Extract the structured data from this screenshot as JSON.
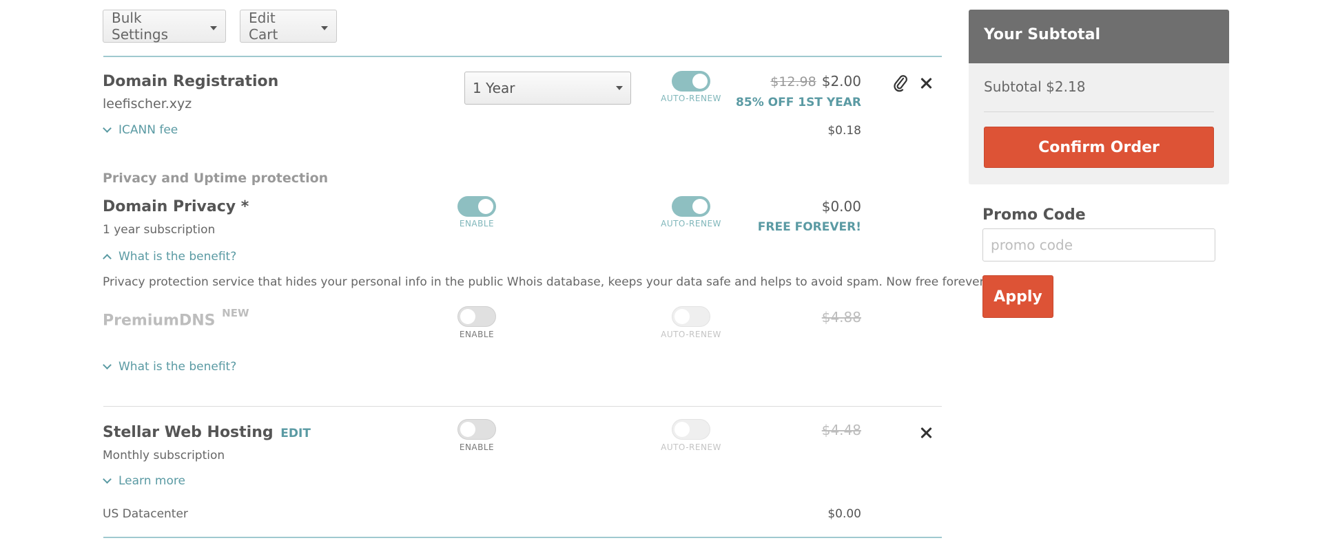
{
  "toolbar": {
    "bulk_settings": "Bulk Settings",
    "edit_cart": "Edit Cart"
  },
  "domain_registration": {
    "title": "Domain Registration",
    "domain": "leefischer.xyz",
    "period": "1 Year",
    "auto_renew": {
      "label": "AUTO-RENEW",
      "on": true
    },
    "old_price": "$12.98",
    "price": "$2.00",
    "promo": "85% OFF 1ST YEAR",
    "icann_link": "ICANN fee",
    "icann_price": "$0.18"
  },
  "privacy_section": {
    "heading": "Privacy and Uptime protection"
  },
  "domain_privacy": {
    "title": "Domain Privacy *",
    "subtitle": "1 year subscription",
    "enable": {
      "label": "ENABLE",
      "on": true
    },
    "auto_renew": {
      "label": "AUTO-RENEW",
      "on": true
    },
    "price": "$0.00",
    "promo": "FREE FOREVER!",
    "benefit_link": "What is the benefit?",
    "benefit_text": "Privacy protection service that hides your personal info in the public Whois database, keeps your data safe and helps to avoid spam. Now free forever!"
  },
  "premium_dns": {
    "title": "PremiumDNS",
    "badge": "NEW",
    "enable": {
      "label": "ENABLE",
      "on": false
    },
    "auto_renew": {
      "label": "AUTO-RENEW",
      "on": false
    },
    "price": "$4.88",
    "benefit_link": "What is the benefit?"
  },
  "web_hosting": {
    "title": "Stellar Web Hosting",
    "edit": "EDIT",
    "subtitle": "Monthly subscription",
    "enable": {
      "label": "ENABLE",
      "on": false
    },
    "auto_renew": {
      "label": "AUTO-RENEW",
      "on": false
    },
    "price": "$4.48",
    "learn_more": "Learn more",
    "datacenter": "US Datacenter",
    "datacenter_price": "$0.00"
  },
  "subtotal_panel": {
    "heading": "Your Subtotal",
    "subtotal": "Subtotal $2.18",
    "confirm": "Confirm Order"
  },
  "promo": {
    "label": "Promo Code",
    "placeholder": "promo code",
    "apply": "Apply"
  },
  "colors": {
    "accent": "#dd5336",
    "teal": "#5a9aa3",
    "header_gray": "#6f6f6f"
  }
}
